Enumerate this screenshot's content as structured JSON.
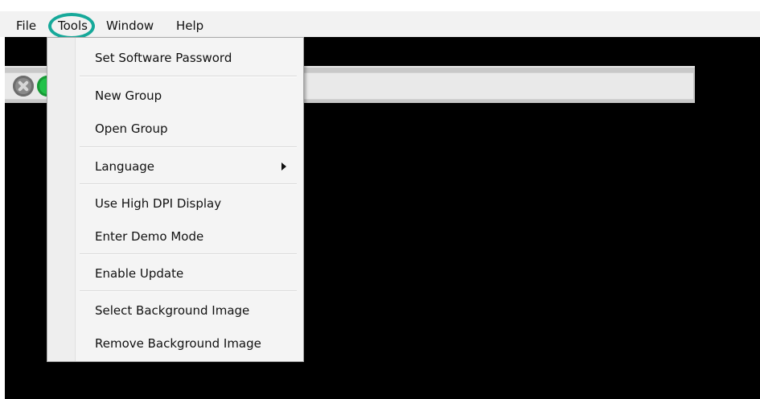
{
  "menubar": {
    "items": [
      {
        "label": "File"
      },
      {
        "label": "Tools"
      },
      {
        "label": "Window"
      },
      {
        "label": "Help"
      }
    ]
  },
  "tools_menu": {
    "items": [
      {
        "label": "Set Software Password"
      },
      {
        "label": "New Group"
      },
      {
        "label": "Open Group"
      },
      {
        "label": "Language",
        "has_submenu": true
      },
      {
        "label": "Use High DPI Display"
      },
      {
        "label": "Enter Demo Mode"
      },
      {
        "label": "Enable Update"
      },
      {
        "label": "Select Background Image"
      },
      {
        "label": "Remove Background Image"
      }
    ]
  },
  "toolbar": {
    "icons": [
      {
        "icon": "close-circle-icon",
        "color": "#8a8a8a"
      },
      {
        "icon": "status-green-icon",
        "color": "#23c24a"
      }
    ]
  },
  "colors": {
    "highlight_ring": "#16a99a",
    "workspace_background": "#000000",
    "menu_background": "#f4f4f4"
  }
}
